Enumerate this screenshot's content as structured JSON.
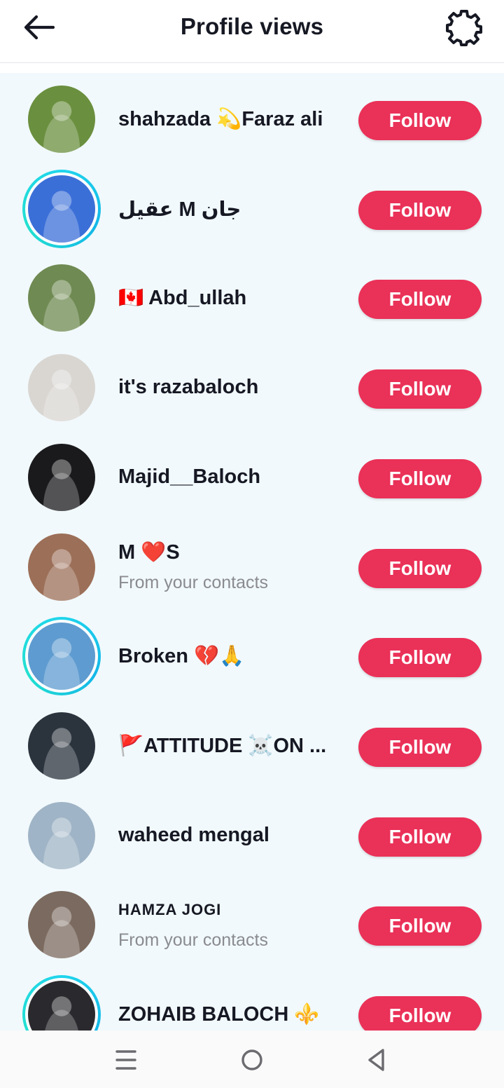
{
  "header": {
    "title": "Profile views",
    "back_icon": "arrow-left-icon",
    "settings_icon": "gear-icon"
  },
  "colors": {
    "follow_button": "#ea3158",
    "list_background": "#f1f9fc",
    "story_ring": "#20d5ec"
  },
  "follow_label": "Follow",
  "viewers": [
    {
      "name": "shahzada 💫Faraz ali",
      "subtitle": "",
      "story_ring": false,
      "avatar_color": "#6a8f3e"
    },
    {
      "name": "عقیل M جان",
      "subtitle": "",
      "story_ring": true,
      "avatar_color": "#3b6fd8"
    },
    {
      "name": "🇨🇦 Abd_ullah",
      "subtitle": "",
      "story_ring": false,
      "avatar_color": "#6f8a52"
    },
    {
      "name": "it's razabaloch",
      "subtitle": "",
      "story_ring": false,
      "avatar_color": "#d9d6d2"
    },
    {
      "name": "Majid__Baloch",
      "subtitle": "",
      "story_ring": false,
      "avatar_color": "#1a1a1c"
    },
    {
      "name": "M ❤️S",
      "subtitle": "From your contacts",
      "story_ring": false,
      "avatar_color": "#9c6f58"
    },
    {
      "name": "Broken 💔🙏",
      "subtitle": "",
      "story_ring": true,
      "avatar_color": "#5e9bd0"
    },
    {
      "name": "🚩ATTITUDE ☠️ON ...",
      "subtitle": "",
      "story_ring": false,
      "avatar_color": "#2b333d"
    },
    {
      "name": "waheed mengal",
      "subtitle": "",
      "story_ring": false,
      "avatar_color": "#9fb4c6"
    },
    {
      "name": "HAMZA JOGI",
      "subtitle": "From your contacts",
      "story_ring": false,
      "avatar_color": "#7b6a5f"
    },
    {
      "name": "ZOHAIB BALOCH ⚜️",
      "subtitle": "",
      "story_ring": true,
      "avatar_color": "#2a2a2e"
    }
  ],
  "navbar": {
    "recents_icon": "menu-lines-icon",
    "home_icon": "circle-home-icon",
    "back_icon": "triangle-back-icon"
  }
}
